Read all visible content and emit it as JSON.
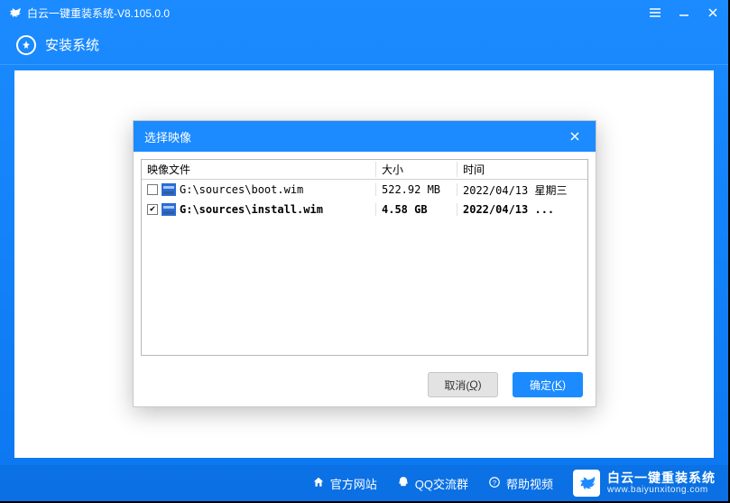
{
  "colors": {
    "accent": "#1b8bff"
  },
  "titlebar": {
    "title": "白云一键重装系统-V8.105.0.0"
  },
  "subheader": {
    "label": "安装系统"
  },
  "bottombar": {
    "links": [
      {
        "label": "官方网站"
      },
      {
        "label": "QQ交流群"
      },
      {
        "label": "帮助视频"
      }
    ],
    "brand_cn": "白云一键重装系统",
    "brand_url": "www.baiyunxitong.com"
  },
  "dialog": {
    "title": "选择映像",
    "columns": {
      "file": "映像文件",
      "size": "大小",
      "time": "时间"
    },
    "rows": [
      {
        "checked": false,
        "path": "G:\\sources\\boot.wim",
        "size": "522.92 MB",
        "time": "2022/04/13 星期三"
      },
      {
        "checked": true,
        "path": "G:\\sources\\install.wim",
        "size": "4.58 GB",
        "time": "2022/04/13 ..."
      }
    ],
    "cancel_label": "取消(",
    "cancel_key": "Q",
    "cancel_suffix": ")",
    "ok_label": "确定(",
    "ok_key": "K",
    "ok_suffix": ")"
  }
}
